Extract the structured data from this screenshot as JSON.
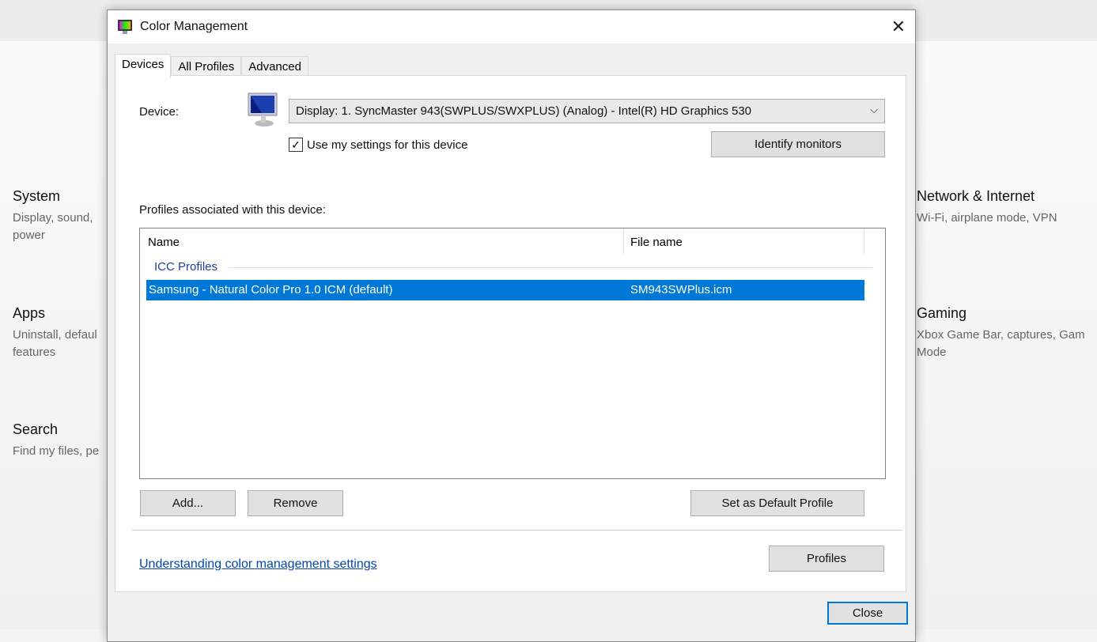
{
  "background": {
    "categories": [
      {
        "title": "System",
        "subtitle": "Display, sound,\npower"
      },
      {
        "title": "Apps",
        "subtitle": "Uninstall, defaul\nfeatures"
      },
      {
        "title": "Search",
        "subtitle": "Find my files, pe"
      },
      {
        "title": "Network & Internet",
        "subtitle": "Wi-Fi, airplane mode, VPN"
      },
      {
        "title": "Gaming",
        "subtitle": "Xbox Game Bar, captures, Gam\nMode"
      }
    ]
  },
  "dialog": {
    "title": "Color Management",
    "tabs": [
      "Devices",
      "All Profiles",
      "Advanced"
    ],
    "device_label": "Device:",
    "device_value": "Display: 1. SyncMaster 943(SWPLUS/SWXPLUS) (Analog) - Intel(R) HD Graphics 530",
    "use_settings_label": "Use my settings for this device",
    "use_settings_checked": true,
    "identify_button": "Identify monitors",
    "profiles_label": "Profiles associated with this device:",
    "columns": [
      "Name",
      "File name"
    ],
    "group": "ICC Profiles",
    "rows": [
      {
        "name": "Samsung - Natural Color Pro 1.0 ICM (default)",
        "file": "SM943SWPlus.icm",
        "selected": true
      }
    ],
    "add_button": "Add...",
    "remove_button": "Remove",
    "default_button": "Set as Default Profile",
    "link": "Understanding color management settings",
    "profiles_button": "Profiles",
    "close_button": "Close"
  },
  "colors": {
    "selection": "#0078d7",
    "link": "#0645ad"
  }
}
